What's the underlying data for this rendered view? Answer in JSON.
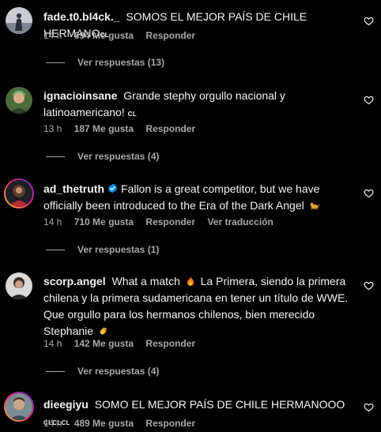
{
  "comments": [
    {
      "username": "fade.t0.bl4ck._",
      "text": "SOMOS EL MEJOR PAÍS DE CHILE HERMANO",
      "flag": "CL",
      "time": "14 h",
      "likes": "694 Me gusta",
      "reply": "Responder",
      "view_replies": "Ver respuestas (13)"
    },
    {
      "username": "ignacioinsane",
      "text": "Grande stephy orgullo nacional y latinoamericano!",
      "flag": "CL",
      "time": "13 h",
      "likes": "187 Me gusta",
      "reply": "Responder",
      "view_replies": "Ver respuestas (4)"
    },
    {
      "username": "ad_thetruth",
      "text": "Fallon is a great competitor, but we have officially been introduced to the Era of the Dark Angel",
      "emoji": "dog-emoji",
      "time": "14 h",
      "likes": "710 Me gusta",
      "reply": "Responder",
      "translate": "Ver traducción",
      "view_replies": "Ver respuestas (1)"
    },
    {
      "username": "scorp.angel",
      "text_part1": "What a match",
      "emoji1": "fire-emoji",
      "text_part2": "La Primera, siendo la primera chilena y la primera sudamericana en tener un título de WWE. Que orgullo para los hermanos chilenos, bien merecido Stephanie",
      "emoji2": "clap-emoji",
      "time": "14 h",
      "likes": "142 Me gusta",
      "reply": "Responder",
      "view_replies": "Ver respuestas (4)"
    },
    {
      "username": "dieegiyu",
      "text": "SOMO EL MEJOR PAÍS DE CHILE HERMANOOO",
      "flags": "CLCLCL",
      "time": "14 h",
      "likes": "489 Me gusta",
      "reply": "Responder"
    }
  ],
  "icons": {
    "like": "heart-outline-icon",
    "verified": "verified-badge-icon"
  },
  "colors": {
    "background": "#000000",
    "text": "#f5f5f5",
    "secondary": "#a8a8a8",
    "verified": "#0095f6"
  }
}
